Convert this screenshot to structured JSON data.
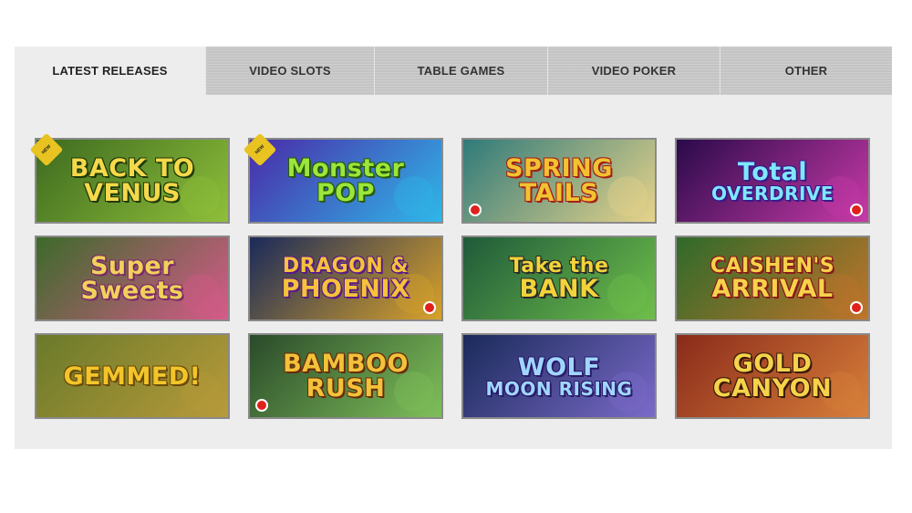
{
  "tabs": [
    {
      "label": "LATEST RELEASES",
      "active": true
    },
    {
      "label": "VIDEO SLOTS",
      "active": false
    },
    {
      "label": "TABLE GAMES",
      "active": false
    },
    {
      "label": "VIDEO POKER",
      "active": false
    },
    {
      "label": "OTHER",
      "active": false
    }
  ],
  "games": [
    {
      "line1": "BACK TO",
      "line2": "VENUS",
      "new": true,
      "colors": {
        "bg": "#3d6a1f",
        "bg2": "#8fbf3a",
        "text": "#f5d94a",
        "stroke": "#1f3a0a"
      }
    },
    {
      "line1": "Monster",
      "line2": "POP",
      "new": true,
      "colors": {
        "bg": "#4a2aa8",
        "bg2": "#2fb7e8",
        "text": "#9be63a",
        "stroke": "#2a5a0a"
      }
    },
    {
      "line1": "SPRING",
      "line2": "TAILS",
      "new": false,
      "colors": {
        "bg": "#2f7a7a",
        "bg2": "#e7d38a",
        "text": "#f2c230",
        "stroke": "#a3201a"
      }
    },
    {
      "line1": "Total",
      "line2": "OVERDRIVE",
      "new": false,
      "colors": {
        "bg": "#2a0a4a",
        "bg2": "#c83aa8",
        "text": "#7fe8ff",
        "stroke": "#3a1a8a"
      }
    },
    {
      "line1": "Super",
      "line2": "Sweets",
      "new": false,
      "colors": {
        "bg": "#3c6a2a",
        "bg2": "#d65a8a",
        "text": "#f0d15a",
        "stroke": "#7a2a6a"
      }
    },
    {
      "line1": "DRAGON &",
      "line2": "PHOENIX",
      "new": false,
      "colors": {
        "bg": "#1a2a5a",
        "bg2": "#d8a22a",
        "text": "#f5c23a",
        "stroke": "#5a1a8a"
      }
    },
    {
      "line1": "Take the",
      "line2": "BANK",
      "new": false,
      "colors": {
        "bg": "#1f5a3a",
        "bg2": "#6fbf4a",
        "text": "#f2d33a",
        "stroke": "#2a2a2a"
      }
    },
    {
      "line1": "CAISHEN'S",
      "line2": "ARRIVAL",
      "new": false,
      "colors": {
        "bg": "#2f6a2a",
        "bg2": "#c0742a",
        "text": "#f5d24a",
        "stroke": "#8a1a1a"
      }
    },
    {
      "line1": "GEMMED!",
      "line2": "",
      "new": false,
      "colors": {
        "bg": "#6a7a2a",
        "bg2": "#b89a3a",
        "text": "#f2c52a",
        "stroke": "#6a4a0a"
      }
    },
    {
      "line1": "BAMBOO",
      "line2": "RUSH",
      "new": false,
      "colors": {
        "bg": "#2a4a2a",
        "bg2": "#7fbf5a",
        "text": "#f2c23a",
        "stroke": "#6a2a0a"
      }
    },
    {
      "line1": "WOLF",
      "line2": "MOON RISING",
      "new": false,
      "colors": {
        "bg": "#1a2a5a",
        "bg2": "#7a6ac8",
        "text": "#9fd6ff",
        "stroke": "#2a1a6a"
      }
    },
    {
      "line1": "GOLD",
      "line2": "CANYON",
      "new": false,
      "colors": {
        "bg": "#8a2a1a",
        "bg2": "#d8803a",
        "text": "#f5d24a",
        "stroke": "#3a1a0a"
      }
    }
  ],
  "new_badge_text": "NEW"
}
